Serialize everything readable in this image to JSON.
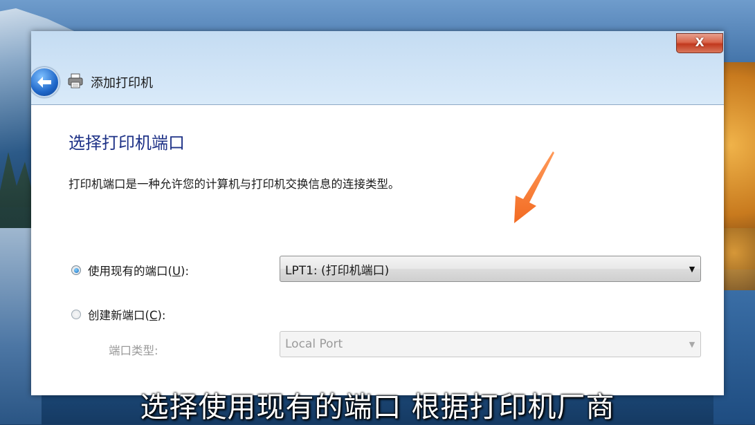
{
  "window": {
    "title": "添加打印机",
    "close_label": "X"
  },
  "page": {
    "heading": "选择打印机端口",
    "description": "打印机端口是一种允许您的计算机与打印机交换信息的连接类型。"
  },
  "options": {
    "use_existing": {
      "label_prefix": "使用现有的端口(",
      "mnemonic": "U",
      "label_suffix": "):",
      "selected": true,
      "combo_value": "LPT1: (打印机端口)"
    },
    "create_new": {
      "label_prefix": "创建新端口(",
      "mnemonic": "C",
      "label_suffix": "):",
      "selected": false,
      "port_type_label": "端口类型:",
      "port_type_value": "Local Port"
    }
  },
  "annotation": {
    "subtitle": "选择使用现有的端口 根据打印机厂商",
    "arrow_color": "#f26a21"
  },
  "icons": {
    "back": "back-arrow-icon",
    "printer": "printer-icon",
    "dropdown": "chevron-down-icon"
  }
}
